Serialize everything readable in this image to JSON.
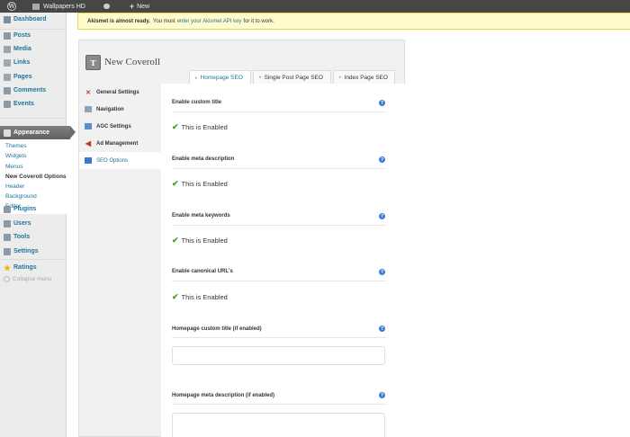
{
  "adminbar": {
    "site_name": "Wallpapers HD",
    "new_label": "New"
  },
  "sidebar": {
    "items": [
      {
        "label": "Dashboard",
        "icon": "dashboard-icon"
      },
      {
        "label": "Posts",
        "icon": "posts-icon"
      },
      {
        "label": "Media",
        "icon": "media-icon"
      },
      {
        "label": "Links",
        "icon": "links-icon"
      },
      {
        "label": "Pages",
        "icon": "pages-icon"
      },
      {
        "label": "Comments",
        "icon": "comments-icon"
      },
      {
        "label": "Events",
        "icon": "events-icon"
      },
      {
        "label": "Appearance",
        "icon": "appearance-icon"
      },
      {
        "label": "Plugins",
        "icon": "plugins-icon"
      },
      {
        "label": "Users",
        "icon": "users-icon"
      },
      {
        "label": "Tools",
        "icon": "tools-icon"
      },
      {
        "label": "Settings",
        "icon": "settings-icon"
      },
      {
        "label": "Ratings",
        "icon": "star-icon"
      }
    ],
    "submenu": [
      "Themes",
      "Widgets",
      "Menus",
      "New Coveroll Options",
      "Header",
      "Background",
      "Editor"
    ],
    "collapse_label": "Collapse menu"
  },
  "notice": {
    "bold": "Akismet is almost ready.",
    "pre": "You must",
    "link": "enter your Akismet API key",
    "post": "for it to work."
  },
  "panel": {
    "title": "New Coveroll",
    "tabs": [
      "Homepage SEO",
      "Single Post Page SEO",
      "Index Page SEO"
    ],
    "nav": [
      {
        "label": "General Settings",
        "icon": "cross-tools-icon"
      },
      {
        "label": "Navigation",
        "icon": "navigation-icon"
      },
      {
        "label": "AGC Settings",
        "icon": "agc-icon"
      },
      {
        "label": "Ad Management",
        "icon": "megaphone-icon"
      },
      {
        "label": "SEO Options",
        "icon": "seo-icon"
      }
    ],
    "options": [
      {
        "label": "Enable custom title",
        "status": "This is Enabled"
      },
      {
        "label": "Enable meta description",
        "status": "This is Enabled"
      },
      {
        "label": "Enable meta keywords",
        "status": "This is Enabled"
      },
      {
        "label": "Enable canonical URL's",
        "status": "This is Enabled"
      }
    ],
    "fields": [
      {
        "label": "Homepage custom title (if enabled)",
        "value": ""
      },
      {
        "label": "Homepage meta description (if enabled)",
        "value": ""
      }
    ]
  },
  "colors": {
    "link": "#21759b",
    "adminbar": "#464646",
    "notice_bg": "#fffbcc",
    "check": "#4a9d1c"
  }
}
